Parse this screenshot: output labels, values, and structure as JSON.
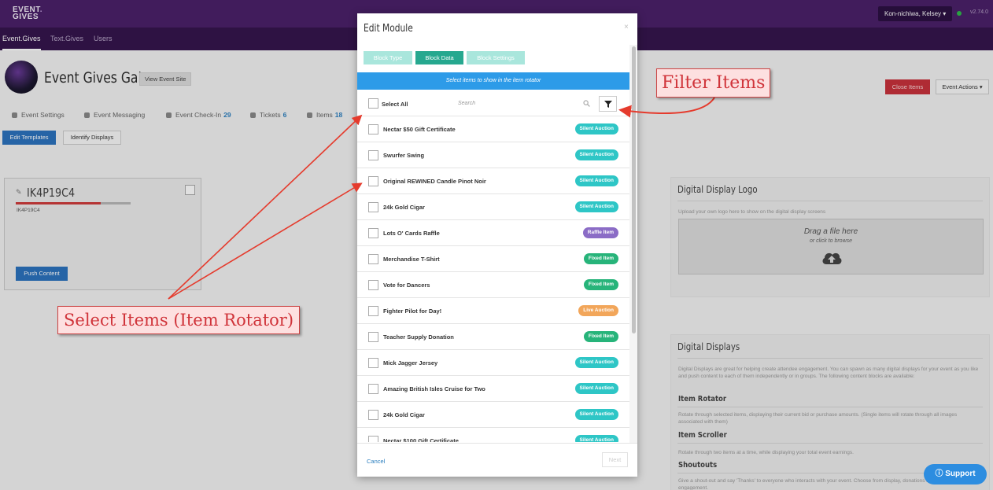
{
  "app": {
    "logo": "EVENT.\nGIVES",
    "user": "Kon-nichiwa, Kelsey",
    "version": "v2.74.0"
  },
  "nav": [
    {
      "label": "Event.Gives",
      "active": true
    },
    {
      "label": "Text.Gives",
      "active": false
    },
    {
      "label": "Users",
      "active": false
    }
  ],
  "event": {
    "title": "Event Gives Gala",
    "view_site": "View Event Site",
    "close_items": "Close Items",
    "event_actions": "Event Actions"
  },
  "sub_tabs": [
    {
      "label": "Event Settings",
      "count": null
    },
    {
      "label": "Event Messaging",
      "count": null
    },
    {
      "label": "Event Check-In",
      "count": "29"
    },
    {
      "label": "Tickets",
      "count": "6"
    },
    {
      "label": "Items",
      "count": "18"
    }
  ],
  "toolbar": {
    "edit_templates": "Edit Templates",
    "identify_displays": "Identify Displays"
  },
  "display_card": {
    "name": "IK4P19C4",
    "sub": "IK4P19C4",
    "push": "Push Content",
    "progress": 0.74
  },
  "logo_panel": {
    "title": "Digital Display Logo",
    "desc": "Upload your own logo here to show on the digital display screens",
    "drop_title": "Drag a file here",
    "drop_sub": "or click to browse"
  },
  "displays_panel": {
    "title": "Digital Displays",
    "desc": "Digital Displays are great for helping create attendee engagement. You can spawn as many digital displays for your event as you like and push content to each of them independently or in groups. The following content blocks are available:",
    "blocks": [
      {
        "name": "Item Rotator",
        "desc": "Rotate through selected items, displaying their current bid or purchase amounts. (Single items will rotate through all images associated with them)"
      },
      {
        "name": "Item Scroller",
        "desc": "Rotate through two items at a time, while displaying your total event earnings."
      },
      {
        "name": "Shoutouts",
        "desc": "Give a shout-out and say 'Thanks' to everyone who interacts with your event. Choose from display, donations and other types of event engagement."
      }
    ]
  },
  "modal": {
    "title": "Edit Module",
    "close": "×",
    "tabs": [
      {
        "label": "Block Type",
        "active": false
      },
      {
        "label": "Block Data",
        "active": true
      },
      {
        "label": "Block Settings",
        "active": false
      }
    ],
    "banner": "Select items to show in the item rotator",
    "select_all": "Select All",
    "search_placeholder": "Search",
    "items": [
      {
        "name": "Nectar $50 Gift Certificate",
        "type": "Silent Auction"
      },
      {
        "name": "Swurfer Swing",
        "type": "Silent Auction"
      },
      {
        "name": "Original REWINED Candle Pinot Noir",
        "type": "Silent Auction"
      },
      {
        "name": "24k Gold Cigar",
        "type": "Silent Auction"
      },
      {
        "name": "Lots O' Cards Raffle",
        "type": "Raffle Item"
      },
      {
        "name": "Merchandise T-Shirt",
        "type": "Fixed Item"
      },
      {
        "name": "Vote for Dancers",
        "type": "Fixed Item"
      },
      {
        "name": "Fighter Pilot for Day!",
        "type": "Live Auction"
      },
      {
        "name": "Teacher Supply Donation",
        "type": "Fixed Item"
      },
      {
        "name": "Mick Jagger Jersey",
        "type": "Silent Auction"
      },
      {
        "name": "Amazing British Isles Cruise for Two",
        "type": "Silent Auction"
      },
      {
        "name": "24k Gold Cigar",
        "type": "Silent Auction"
      },
      {
        "name": "Nectar $100 Gift Certificate",
        "type": "Silent Auction"
      }
    ],
    "cancel": "Cancel",
    "next": "Next"
  },
  "badge_colors": {
    "Silent Auction": "#2ec6c6",
    "Raffle Item": "#8b6cc6",
    "Fixed Item": "#27b47a",
    "Live Auction": "#f2a65a"
  },
  "annotations": {
    "filter": "Filter Items",
    "select": "Select Items (Item Rotator)"
  },
  "support": "Support"
}
